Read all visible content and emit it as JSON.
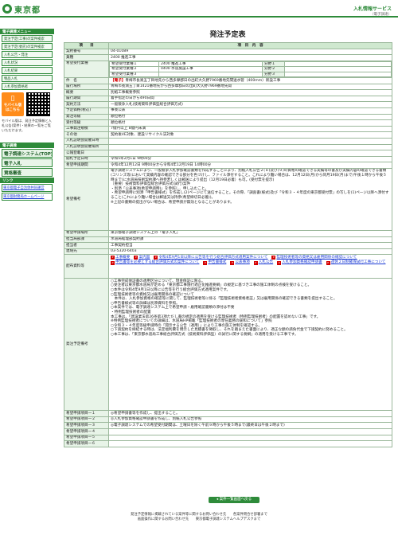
{
  "header": {
    "logo": "東京都",
    "right_title": "入札情報サービス",
    "right_sub": "（電子調達）"
  },
  "sidebar": {
    "section_title": "電子調達メニュー",
    "items": [
      "発注予定(工事)の案件検索",
      "発注予定(委託)の案件検索",
      "入札公告・発注",
      "入札状況",
      "入札結果",
      "物品入札",
      "入札参加資格者"
    ],
    "mobile_label": "モバイル版",
    "mobile_sub": "はこちら",
    "note": "モバイル版は、発注予定情報と入札公告(案件)・結果の一覧をご覧いただけます。",
    "link_section": "電子調達",
    "big_items": [
      "電子調達システム(TOP)",
      "電子入札",
      "資格審査"
    ],
    "link_head": "リンク",
    "links": [
      "東京都電子自治体共同運営",
      "東京都財務局ホームページ"
    ]
  },
  "main": {
    "title": "発注予定表",
    "table_header_item": "項　　目",
    "table_header_content": "項　目　内　容",
    "rows": {
      "contract_no_label": "契約番号",
      "contract_no": "04-01089",
      "business_label": "業種",
      "business": "2400 推進工事",
      "desired_label": "希望受付業種",
      "desired": [
        {
          "name": "希望受付業種１",
          "value": "2400 推進工事",
          "rank_label": "分野１",
          "rank": ""
        },
        {
          "name": "希望受付業種２",
          "value": "0400 水道施設工事",
          "rank_label": "分野２",
          "rank": ""
        },
        {
          "name": "希望受付業種３",
          "value": "",
          "rank_label": "分野３",
          "rank": ""
        }
      ],
      "name_label": "件　名",
      "name_tag": "【電子】",
      "name": "青梅市長渕五丁目地先から西多摩郡日の出町大久野7969番地先間送水管（400mm）新設工事",
      "place_label": "履行場所",
      "place": "青梅市長渕五丁目1421番地先から西多摩郡日の出町大久野7969番地先間",
      "summary_label": "概要",
      "summary": "別紙工事概要参照",
      "period_label": "履行期間",
      "period": "着手指定の日から490日間",
      "method_label": "契約方法",
      "method": "一般競争入札(技術資料評価型総合評価方式)",
      "price_label": "予定価格(税込)",
      "price": "事後公表",
      "section_label": "発注等級",
      "section": "順位格付",
      "accept_label": "受付等級",
      "accept": "順位格付",
      "type_label": "工事発注規模",
      "type": "7億円以上 8億円未満",
      "other_label": "その他",
      "other": "契約後VE対象、建設リサイクル法対象",
      "s1_label": "入札説明会開催日時",
      "s1": "",
      "s2_label": "入札説明会開催場所",
      "s2": "",
      "s3_label": "公報登載日",
      "s3": "",
      "open_label": "開札予定日時",
      "open": "令和5年2月1日 9時00分",
      "apply_label": "希望申請期間",
      "apply": "令和4年12月12日 9時00分から令和4年12月19日 14時00分",
      "notes_label": "希望備考",
      "notes": "電子調達システムにより、一般競争入札参加確認書類を作成することにより、別紙入札公告２(８)及び(９)の資格の確認できる実績等の書及び実績内容の確認できる書類(コリンズ等)において実績内容の確認できる部分を色づけし、ファイル添付すること。これにより難い場合は、12月12日(月)から同月19日(月)まで(午後１時から午後５時まで)に水道局技術契約課へ持参若しくは郵送により提出（12月19日必着）も可。(受付票を提示)\n（重要）技術資料評価型総合評価方式(試行)案件\n・別添「公表事項(希望申請時)」を参照し、申し込むこと。\n・希望申請時に別添「申告書様式」を作成し(2)ページにて送信すること。その際、「調査書(様式)及び「令和３・４年度の東京都受付票」の写しを(1)ページ以降へ添付すること(これにより難い場合は郵送又は持参(希望締切日必着))。\n※上記の書類の提出がない場合は、希望申請が無効となることがあります。",
      "contact_label": "希望申請場所",
      "contact": "東京都電子調達システム上の「電子入札」",
      "dept_label": "担当局部課",
      "dept": "水道局経理部契約課",
      "person_label": "担当者",
      "person": "工事契約担当",
      "tel_label": "連絡先",
      "tel": "03-5320-6403",
      "docs_label": "配布資料等",
      "docs": [
        "工事概要",
        "案内図",
        "令和4年9月1日以降に公告等を行う総合評価方式適用案件について",
        "監理技術者等の資格又は雇用関係の確認について",
        "申告書等を必要とする総合評価方式の案件について",
        "申告書様式",
        "公表事項",
        "入札公告",
        "入札参加資格確認申請書",
        "週休２日制確保試行工事について"
      ],
      "notes2_label": "発注予定備考",
      "notes2": "○工事完成保証書の適用区分について、現金保証に限る。\n○受注者は東京都水道局が定める「東京都工事施行適正化推進要綱」の規定に基づき工事の施工体制の点検を受けること。\n○本件は令和4年9月1日以降に公告等を行う総合評価方式適用案件です。\n○監理技術者等の資格又は雇用関係の確認について\n　本件は、入札参加資格の確認等に関して、監理技術者等に係る「監理技術者資格者証」又は雇用関係の確認できる書類を提出すること。\n○申告書様式等の詳細は別添資料を参照。\n○本案件では、電子調達システム上で希望申請・雇用確認書類の添付は不要\n・特例監理技術者の配置\n本工事は、「建設業法第26条第3項ただし書の規定の適用を受ける監理技術者（特例監理技術者）の配置を認めない工事」です。\n※特例監理技術者についての詳細は、水道局HP掲載「監理技術者の専任義務の緩和について」参照\n○令和３・４年度等級申請時の「開示する公告（適用）」により工事の施工体制を確認する。\n○下請契約を締結する時は、法定福利費を明示した見積書を徴取し、それを踏まえた書面により、適正な額の請負代金で下請契約に努めること。\n○本工事は、「東京都水道局工事総合評価方式（技術資料評価型）の試行に関する要綱」の適用を受ける工事です。",
      "sup_labels": [
        "希望申請項目一１",
        "希望申請項目一２",
        "希望申請項目一３",
        "希望申請項目一４",
        "希望申請項目一５",
        "希望申請項目一６"
      ],
      "sup1": "◎希望申請書等を作成し、提出すること。",
      "sup2": "◎入札参加資格確認申請書を作成し、別紙入札公告参照",
      "sup3": "◎電子調達システムでの希望受付期間は、土曜日を除く午前９時から午後５時まで(最終日は午後２時まで)"
    },
    "return_button": "案件一覧画面へ戻る"
  },
  "footer": {
    "line1": "発注予定情報に掲載されている案件等に関するお問い合わせ先　　各案件問合せ部署まで",
    "line2": "画面操作に関するお問い合わせ先　　東京都電子調達システムヘルプデスクまで"
  }
}
